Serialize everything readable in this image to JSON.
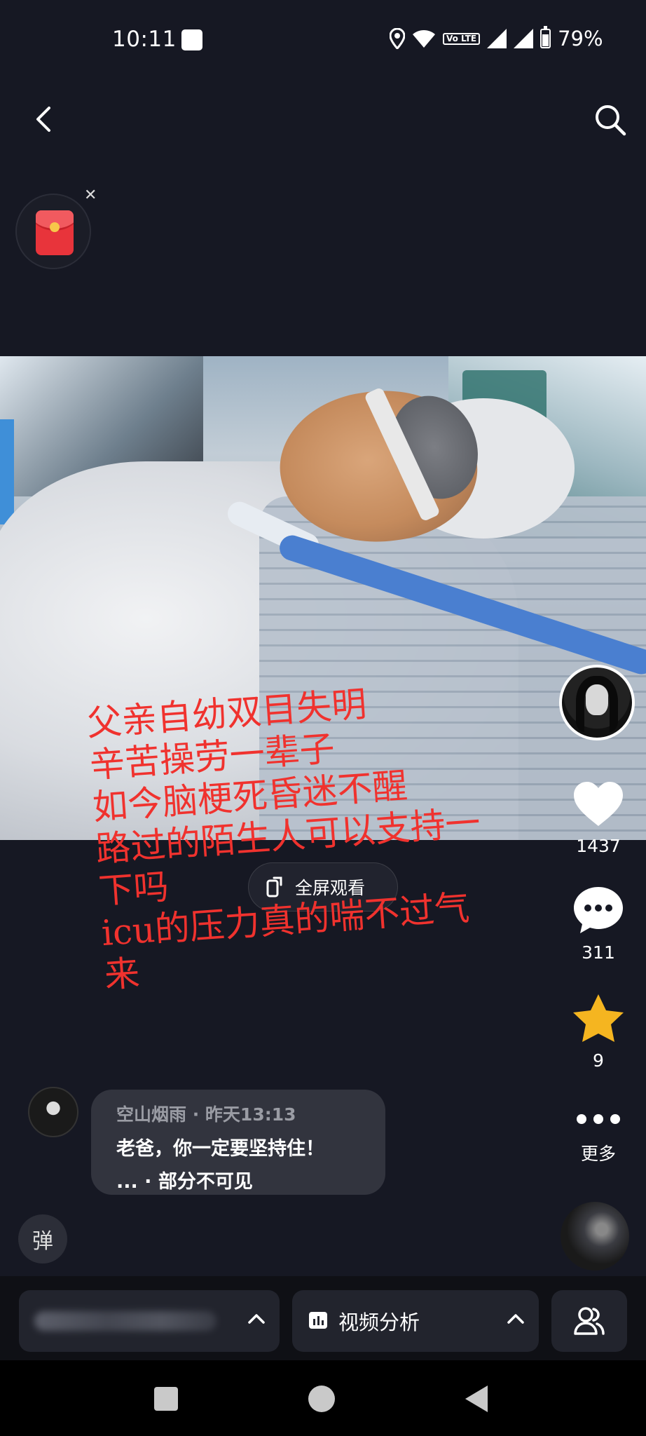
{
  "status_bar": {
    "time": "10:11",
    "volte_label": "Vo LTE",
    "battery": "79%"
  },
  "video": {
    "overlay_text": "父亲自幼双目失明\n辛苦操劳一辈子\n如今脑梗死昏迷不醒\n路过的陌生人可以支持一\n下吗\nicu的压力真的喘不过气\n来",
    "fullscreen_label": "全屏观看"
  },
  "rail": {
    "likes": "1437",
    "comments": "311",
    "favorites": "9",
    "more_label": "更多"
  },
  "comment": {
    "user": "空山烟雨",
    "time": "· 昨天13:13",
    "text": "老爸，你一定要坚持住！",
    "sub": "... · 部分不可见"
  },
  "danmu_label": "弹",
  "bottom": {
    "analysis_label": "视频分析"
  },
  "colors": {
    "background": "#161823",
    "overlay_text": "#f0322e",
    "favorite": "#f5b520",
    "tube": "#4a7fd0"
  },
  "icons": [
    "back-icon",
    "search-icon",
    "red-packet-icon",
    "close-icon",
    "heart-icon",
    "comment-icon",
    "star-icon",
    "more-icon",
    "fullscreen-icon",
    "chart-icon",
    "chevron-up-icon",
    "friends-icon"
  ]
}
